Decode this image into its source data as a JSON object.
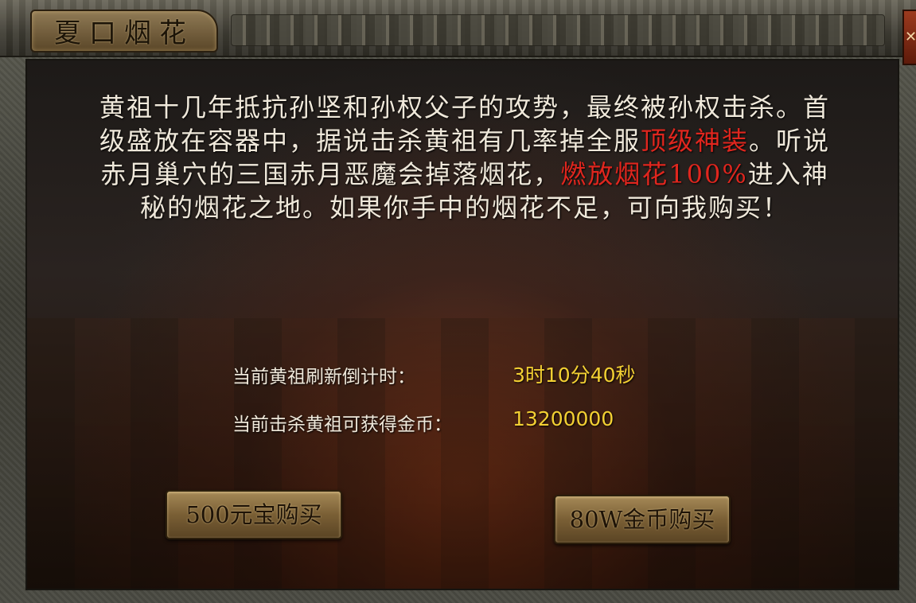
{
  "window": {
    "title": "夏口烟花",
    "close_glyph": "✕"
  },
  "story": {
    "part1": "黄祖十几年抵抗孙坚和孙权父子的攻势，最终被孙权击杀。首级盛放在容器中，据说击杀黄祖有几率掉全服",
    "highlight1": "顶级神装",
    "part2": "。听说赤月巢穴的三国赤月恶魔会掉落烟花，",
    "highlight2": "燃放烟花100%",
    "part3": "进入神秘的烟花之地。如果你手中的烟花不足，可向我购买！"
  },
  "info": {
    "countdown_label": "当前黄祖刷新倒计时：",
    "countdown_value": "3时10分40秒",
    "reward_label": "当前击杀黄祖可获得金币：",
    "reward_value": "13200000"
  },
  "buttons": {
    "buy_yuanbao": "500元宝购买",
    "buy_gold": "80W金币购买"
  },
  "colors": {
    "highlight_red": "#e0261e",
    "value_yellow": "#f3d033",
    "text": "#efe8da"
  }
}
